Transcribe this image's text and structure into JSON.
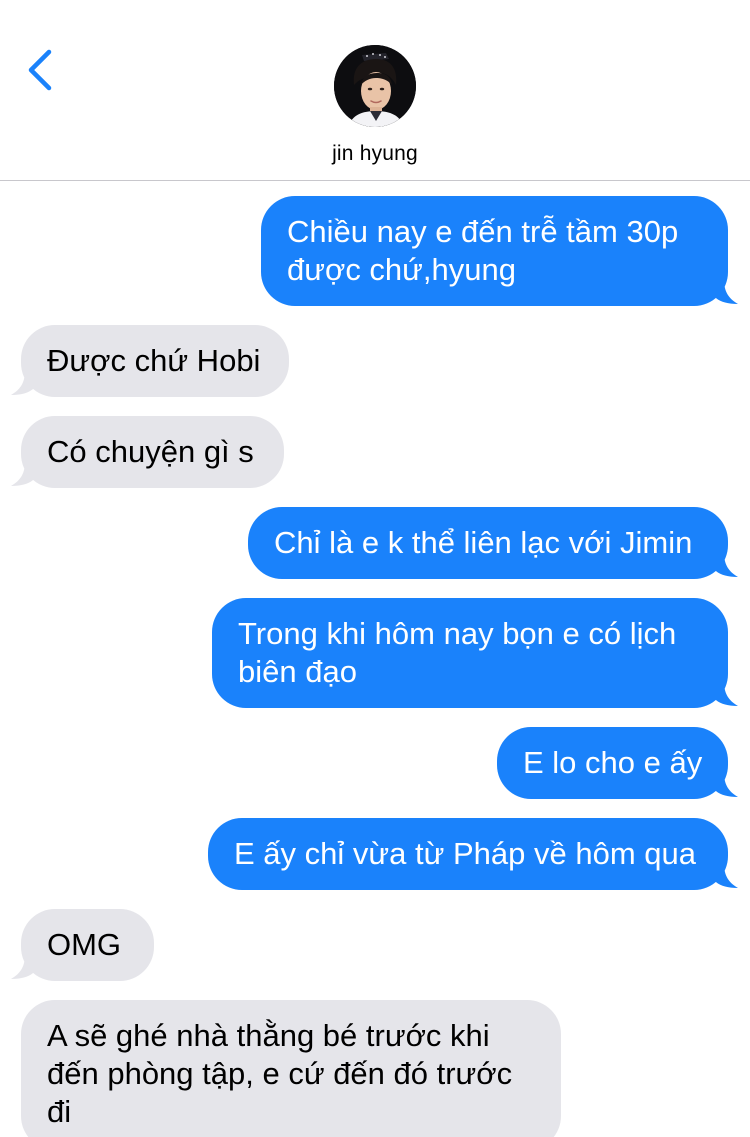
{
  "colors": {
    "accent": "#1a82fb",
    "outgoing_bubble": "#1a82fb",
    "incoming_bubble": "#e5e5ea",
    "battery": "#ffcc00",
    "divider": "#c8c7cc"
  },
  "header": {
    "back_icon": "chevron-left-icon",
    "contact_name": "jin hyung"
  },
  "messages": [
    {
      "direction": "outgoing",
      "lines": [
        "Chiều nay e đến trễ tầm 30p",
        "được chứ,hyung"
      ]
    },
    {
      "direction": "incoming",
      "lines": [
        "Được chứ Hobi"
      ]
    },
    {
      "direction": "incoming",
      "lines": [
        "Có chuyện gì s"
      ]
    },
    {
      "direction": "outgoing",
      "lines": [
        "Chỉ là e k thể liên lạc với Jimin"
      ]
    },
    {
      "direction": "outgoing",
      "lines": [
        "Trong khi hôm nay bọn e có lịch",
        "biên đạo"
      ]
    },
    {
      "direction": "outgoing",
      "lines": [
        "E lo cho e ấy"
      ]
    },
    {
      "direction": "outgoing",
      "lines": [
        "E ấy chỉ vừa từ Pháp về hôm qua"
      ]
    },
    {
      "direction": "incoming",
      "lines": [
        "OMG"
      ]
    },
    {
      "direction": "incoming",
      "lines": [
        "A sẽ ghé nhà thằng bé trước khi",
        "đến phòng tập, e cứ đến đó trước",
        "đi"
      ]
    }
  ]
}
